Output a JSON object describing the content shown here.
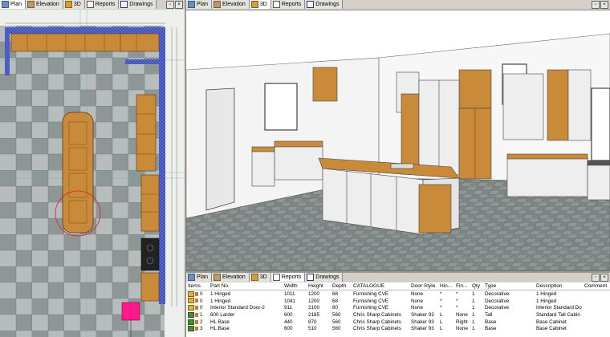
{
  "tabs": {
    "plan": "Plan",
    "elevation": "Elevation",
    "view3d": "3D",
    "reports": "Reports",
    "drawings": "Drawings"
  },
  "icons": {
    "plan": "plan-icon",
    "elevation": "elevation-icon",
    "view3d": "3d-icon",
    "reports": "reports-icon",
    "drawings": "drawings-icon"
  },
  "colors": {
    "wall": "#3d4db8",
    "cabinet": "#c98a3a",
    "floor_tile_dark": "#8f9696",
    "floor_tile_light": "#b7bcbc",
    "handle": "#ff1a8c"
  },
  "report": {
    "columns": [
      "Items",
      "Part No.",
      "Width",
      "Height",
      "Depth",
      "CATALOGUE",
      "Door Style",
      "Hin...",
      "Fin...",
      "Qty",
      "Type",
      "Description",
      "Comment"
    ],
    "rows": [
      {
        "item": "0",
        "part": "1 Hinged",
        "width": "1011",
        "height": "1200",
        "depth": "68",
        "catalogue": "Furnishing CVE",
        "door": "None",
        "hin": "*",
        "fin": "*",
        "qty": "1",
        "type": "Decorative",
        "desc": "1 Hinged",
        "comment": ""
      },
      {
        "item": "0",
        "part": "1 Hinged",
        "width": "1041",
        "height": "1200",
        "depth": "68",
        "catalogue": "Furnishing CVE",
        "door": "None",
        "hin": "*",
        "fin": "*",
        "qty": "1",
        "type": "Decorative",
        "desc": "1 Hinged",
        "comment": ""
      },
      {
        "item": "0",
        "part": "Interior Standard Door-2",
        "width": "911",
        "height": "2100",
        "depth": "80",
        "catalogue": "Furnishing CVE",
        "door": "None",
        "hin": "*",
        "fin": "*",
        "qty": "1",
        "type": "Decorative",
        "desc": "Interior Standard Do",
        "comment": ""
      },
      {
        "item": "1",
        "part": "600 Larder",
        "width": "600",
        "height": "2185",
        "depth": "560",
        "catalogue": "Chris Sharp Cabinets",
        "door": "Shaker 93",
        "hin": "L",
        "fin": "None",
        "qty": "1",
        "type": "Tall",
        "desc": "Standard Tall Cabin",
        "comment": ""
      },
      {
        "item": "2",
        "part": "HL Base",
        "width": "440",
        "height": "870",
        "depth": "560",
        "catalogue": "Chris Sharp Cabinets",
        "door": "Shaker 93",
        "hin": "L",
        "fin": "Right",
        "qty": "1",
        "type": "Base",
        "desc": "Base Cabinet",
        "comment": ""
      },
      {
        "item": "3",
        "part": "HL Base",
        "width": "600",
        "height": "510",
        "depth": "560",
        "catalogue": "Chris Sharp Cabinets",
        "door": "Shaker 93",
        "hin": "L",
        "fin": "None",
        "qty": "1",
        "type": "Base",
        "desc": "Base Cabinet",
        "comment": ""
      }
    ]
  }
}
